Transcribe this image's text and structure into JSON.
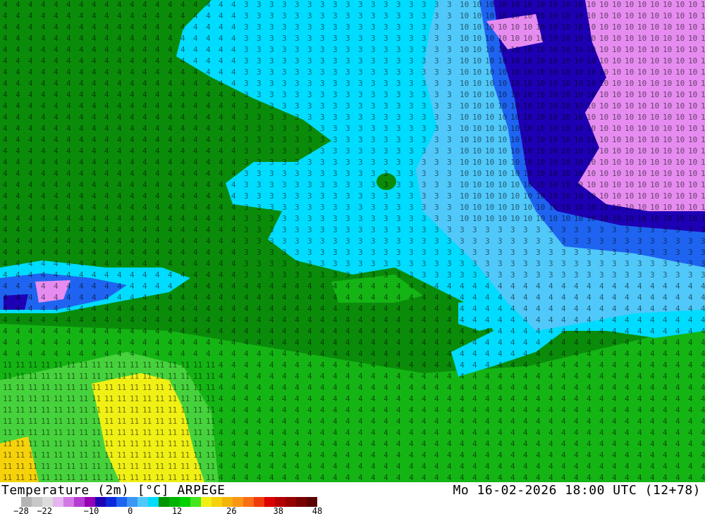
{
  "map": {
    "title": "Temperature (2m) [°C] ARPEGE",
    "run_info": "Mo 16-02-2026 18:00 UTC (12+78)"
  },
  "colorbar": {
    "colors": [
      "#b4b4b4",
      "#c8c8c8",
      "#dcdcdc",
      "#e6b4f0",
      "#d278e6",
      "#b43cd2",
      "#9600b4",
      "#1e00b4",
      "#0a28dc",
      "#1e64f0",
      "#3c96f5",
      "#50c8fa",
      "#00dcff",
      "#009600",
      "#00b400",
      "#00d200",
      "#46e61e",
      "#f0f014",
      "#f5d20a",
      "#f5b40a",
      "#fa9614",
      "#fa6e14",
      "#f03c0a",
      "#dc0000",
      "#b40000",
      "#960000",
      "#780000",
      "#5a0000"
    ],
    "ticks": [
      "-28",
      "-22",
      "-10",
      "0",
      "12",
      "26",
      "38",
      "48"
    ]
  },
  "fields": {
    "warm_colors": {
      "dark_green": "#0a8c0a",
      "green": "#14b414",
      "light_green": "#3cd23c",
      "yellow": "#f0f014",
      "orange": "#f5c80a"
    },
    "cold_colors": {
      "cyan": "#00dcff",
      "light_blue": "#50c8fa",
      "blue": "#1e64f0",
      "dark_blue": "#1e00b4",
      "violet": "#e68cf0"
    }
  }
}
